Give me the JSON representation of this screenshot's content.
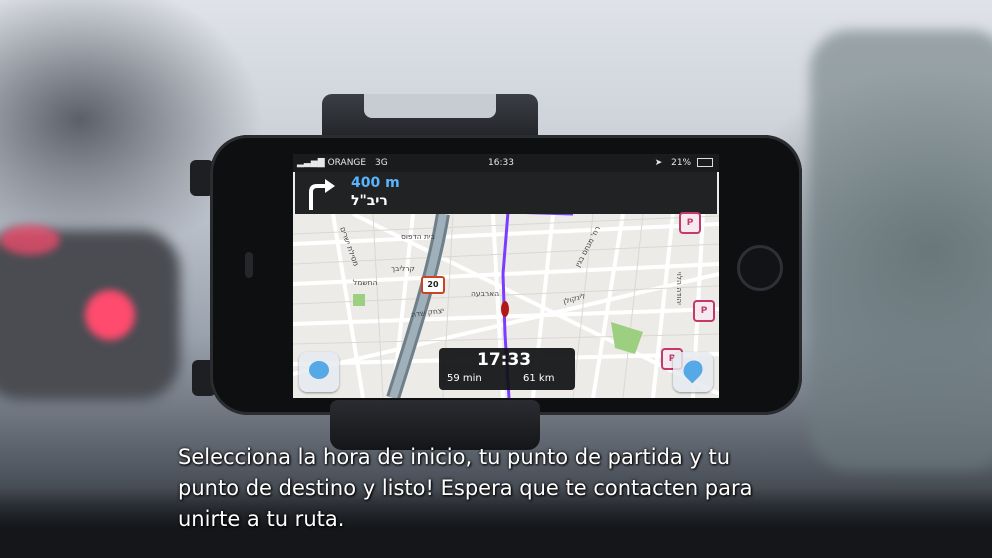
{
  "phone": {
    "status_bar": {
      "carrier": "ORANGE",
      "network": "3G",
      "time": "16:33",
      "battery": "21%"
    },
    "navigation": {
      "distance": "400 m",
      "street": "ריב\"ל",
      "turn_icon": "turn-left-arrow-icon"
    },
    "map": {
      "labels": [
        "רח' מנחם בגין",
        "לינקולן",
        "יצחק שדה",
        "הארבעה",
        "קרליבך",
        "יהודה הלוי",
        "החשמל",
        "בית הדפוס",
        "מסילת ישרים"
      ],
      "speed_limit": "20",
      "parking_marker": "P"
    },
    "eta": {
      "arrival_time": "17:33",
      "duration": "59 min",
      "distance": "61 km"
    }
  },
  "subtitles": [
    "Selecciona la hora de inicio, tu punto de partida y tu",
    "punto de destino y listo! Espera que te contacten para",
    "unirte a tu ruta."
  ]
}
